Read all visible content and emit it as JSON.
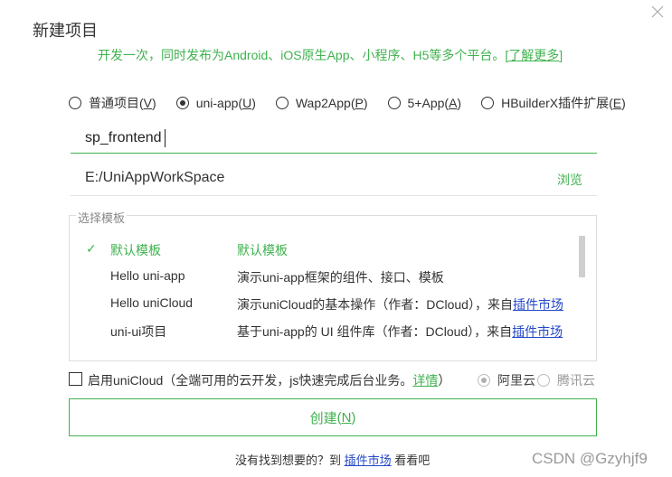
{
  "dialog": {
    "title": "新建项目",
    "subtitle": "开发一次，同时发布为Android、iOS原生App、小程序、H5等多个平台。",
    "subtitle_link": "[了解更多]"
  },
  "project_types": [
    {
      "label": "普通项目",
      "key": "V",
      "selected": false
    },
    {
      "label": "uni-app",
      "key": "U",
      "selected": true
    },
    {
      "label": "Wap2App",
      "key": "P",
      "selected": false
    },
    {
      "label": "5+App",
      "key": "A",
      "selected": false
    },
    {
      "label": "HBuilderX插件扩展",
      "key": "E",
      "selected": false
    }
  ],
  "project_name": {
    "value": "sp_frontend"
  },
  "location": {
    "path": "E:/UniAppWorkSpace",
    "browse_label": "浏览"
  },
  "templates": {
    "legend": "选择模板",
    "items": [
      {
        "check": "✓",
        "name": "默认模板",
        "desc": "默认模板",
        "desc_link": "",
        "selected": true
      },
      {
        "check": "",
        "name": "Hello uni-app",
        "desc": "演示uni-app框架的组件、接口、模板",
        "desc_link": "",
        "selected": false
      },
      {
        "check": "",
        "name": "Hello uniCloud",
        "desc": "演示uniCloud的基本操作（作者：DCloud），来自",
        "desc_link": "插件市场",
        "selected": false
      },
      {
        "check": "",
        "name": "uni-ui项目",
        "desc": "基于uni-app的 UI 组件库（作者：DCloud），来自",
        "desc_link": "插件市场",
        "selected": false
      }
    ]
  },
  "unicloud": {
    "checked": false,
    "label": "启用uniCloud（全端可用的云开发，js快速完成后台业务。",
    "details_link": "详情",
    "label_end": "）",
    "providers": [
      {
        "label": "阿里云",
        "selected": true
      },
      {
        "label": "腾讯云",
        "selected": false
      }
    ]
  },
  "create_button": {
    "label": "创建",
    "key": "N"
  },
  "footer": {
    "prefix": "没有找到想要的？到 ",
    "link": "插件市场",
    "suffix": " 看看吧"
  },
  "watermark": "CSDN @Gzyhjf9",
  "colors": {
    "accent": "#3fb24f",
    "link": "#2448c9"
  }
}
